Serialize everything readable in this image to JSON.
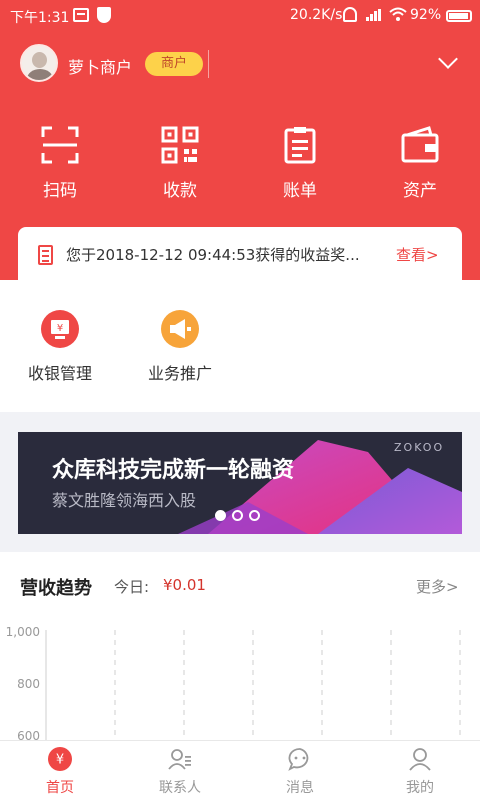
{
  "status_bar": {
    "time": "下午1:31",
    "net_speed": "20.2K/s",
    "battery": "92%"
  },
  "header": {
    "merchant_name": "萝卜商户",
    "badge": "商户"
  },
  "actions": [
    {
      "label": "扫码",
      "icon": "scan-icon"
    },
    {
      "label": "收款",
      "icon": "qr-code-icon"
    },
    {
      "label": "账单",
      "icon": "bill-icon"
    },
    {
      "label": "资产",
      "icon": "wallet-icon"
    }
  ],
  "notice": {
    "text": "您于2018-12-12 09:44:53获得的收益奖...",
    "link": "查看>"
  },
  "quick_menu": [
    {
      "label": "收银管理",
      "icon": "cashier-icon",
      "color": "#ef4745"
    },
    {
      "label": "业务推广",
      "icon": "megaphone-icon",
      "color": "#f7a43a"
    }
  ],
  "banner": {
    "title": "众库科技完成新一轮融资",
    "subtitle": "蔡文胜隆领海西入股",
    "logo": "ZOKOO",
    "pages": 3,
    "active_page": 1
  },
  "trend": {
    "title": "营收趋势",
    "today_label": "今日:",
    "today_value": "¥0.01",
    "more": "更多>"
  },
  "chart_data": {
    "type": "line",
    "y_ticks": [
      "1,000",
      "800",
      "600"
    ],
    "grid": "dashed-vertical"
  },
  "tabs": [
    {
      "label": "首页",
      "icon": "home-yen-icon",
      "active": true
    },
    {
      "label": "联系人",
      "icon": "contacts-icon",
      "active": false
    },
    {
      "label": "消息",
      "icon": "message-icon",
      "active": false
    },
    {
      "label": "我的",
      "icon": "profile-icon",
      "active": false
    }
  ],
  "colors": {
    "brand": "#ef4745",
    "badge": "#fdd24a",
    "accent_orange": "#f7a43a"
  }
}
